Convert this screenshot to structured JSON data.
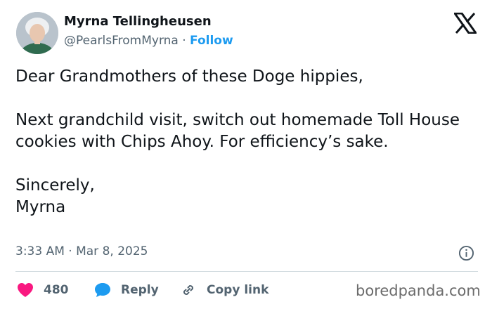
{
  "author": {
    "name": "Myrna Tellingheusen",
    "handle": "@PearlsFromMyrna",
    "separator": "·",
    "follow_label": "Follow"
  },
  "tweet": {
    "lines": [
      "Dear Grandmothers of these Doge hippies,",
      "Next grandchild visit, switch out homemade Toll House cookies with Chips Ahoy. For efficiency’s sake.",
      "Sincerely,",
      "Myrna"
    ],
    "timestamp": "3:33 AM · Mar 8, 2025"
  },
  "actions": {
    "likes": "480",
    "reply_label": "Reply",
    "copy_link_label": "Copy link"
  },
  "watermark": "boredpanda.com",
  "colors": {
    "follow": "#1d9bf0",
    "like": "#f91880",
    "reply": "#1d9bf0",
    "text_primary": "#0f1419",
    "text_secondary": "#536471"
  }
}
